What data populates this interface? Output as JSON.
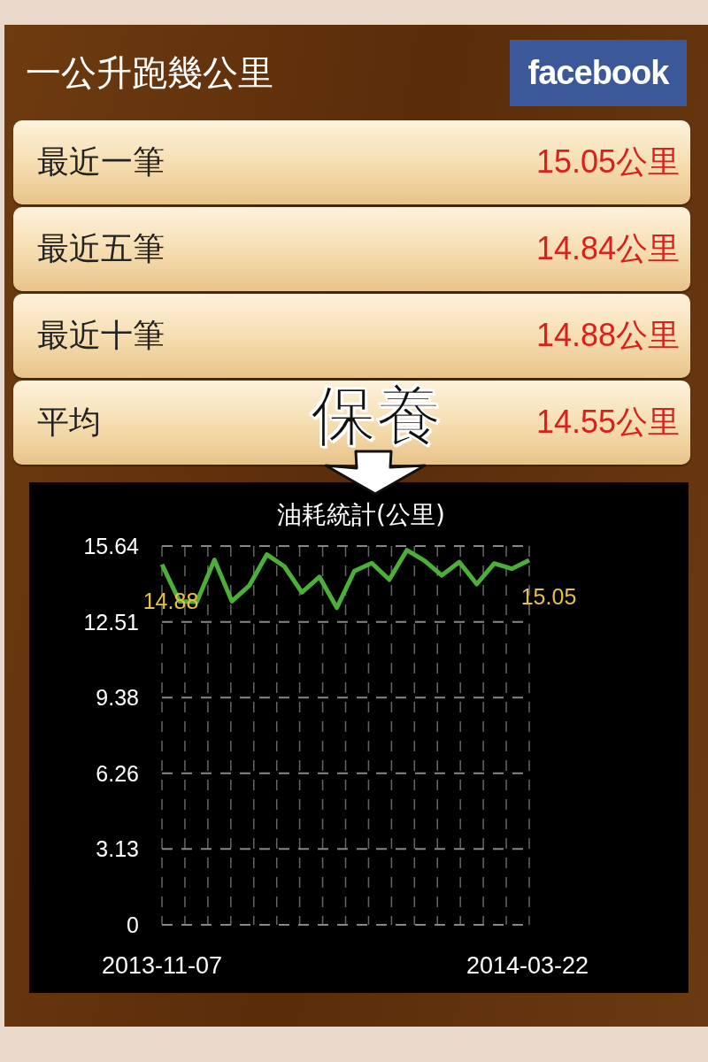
{
  "header": {
    "title": "一公升跑幾公里",
    "share_button": "facebook"
  },
  "stats": [
    {
      "label": "最近一筆",
      "value": "15.05公里"
    },
    {
      "label": "最近五筆",
      "value": "14.84公里"
    },
    {
      "label": "最近十筆",
      "value": "14.88公里"
    },
    {
      "label": "平均",
      "value": "14.55公里"
    }
  ],
  "chart": {
    "chart_data": {
      "type": "line",
      "title": "油耗統計(公里)",
      "ylim": [
        0,
        15.64
      ],
      "yticks": [
        0,
        3.13,
        6.26,
        9.38,
        12.51,
        15.64
      ],
      "grid": true,
      "series": [
        {
          "color": "#4caf37",
          "values": [
            14.88,
            13.36,
            13.34,
            15.07,
            13.36,
            14.01,
            15.29,
            14.8,
            13.73,
            14.37,
            13.09,
            14.61,
            14.94,
            14.25,
            15.47,
            15.04,
            14.43,
            14.98,
            14.07,
            14.92,
            14.7,
            15.05
          ]
        }
      ],
      "annotations": [
        "14.88",
        "15.05"
      ]
    },
    "x_axis_labels": [
      "2013-11-07",
      "2014-03-22"
    ]
  },
  "annotation": {
    "text": "保養"
  }
}
